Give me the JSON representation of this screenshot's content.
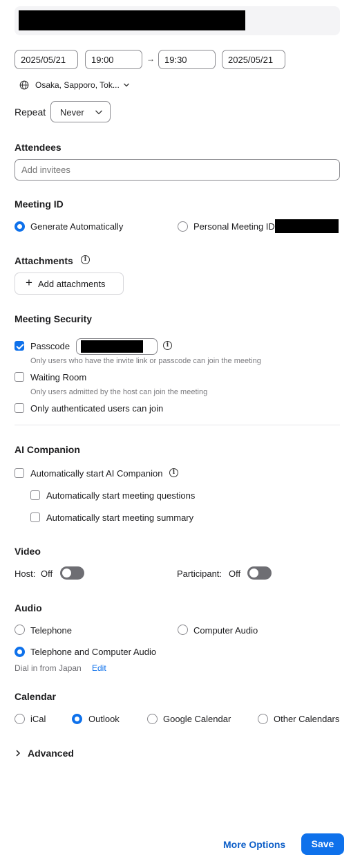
{
  "header": {
    "title_redacted": true
  },
  "schedule": {
    "start_date": "2025/05/21",
    "start_time": "19:00",
    "arrow": "→",
    "end_time": "19:30",
    "end_date": "2025/05/21",
    "timezone": "Osaka, Sapporo, Tok...",
    "repeat_label": "Repeat",
    "repeat_value": "Never"
  },
  "attendees": {
    "heading": "Attendees",
    "placeholder": "Add invitees"
  },
  "meeting_id": {
    "heading": "Meeting ID",
    "generate_label": "Generate Automatically",
    "personal_label": "Personal Meeting ID",
    "selected": "generate"
  },
  "attachments": {
    "heading": "Attachments",
    "add_label": "Add attachments"
  },
  "security": {
    "heading": "Meeting Security",
    "passcode_label": "Passcode",
    "passcode_checked": true,
    "passcode_hint": "Only users who have the invite link or passcode can join the meeting",
    "waiting_room_label": "Waiting Room",
    "waiting_room_checked": false,
    "waiting_room_hint": "Only users admitted by the host can join the meeting",
    "auth_label": "Only authenticated users can join",
    "auth_checked": false
  },
  "ai_companion": {
    "heading": "AI Companion",
    "auto_start_label": "Automatically start AI Companion",
    "questions_label": "Automatically start meeting questions",
    "summary_label": "Automatically start meeting summary"
  },
  "video": {
    "heading": "Video",
    "host_label": "Host:",
    "host_value": "Off",
    "participant_label": "Participant:",
    "participant_value": "Off"
  },
  "audio": {
    "heading": "Audio",
    "telephone_label": "Telephone",
    "computer_label": "Computer Audio",
    "both_label": "Telephone and Computer Audio",
    "selected": "both",
    "dial_in_text": "Dial in from Japan",
    "edit_label": "Edit"
  },
  "calendar": {
    "heading": "Calendar",
    "options": [
      "iCal",
      "Outlook",
      "Google Calendar",
      "Other Calendars"
    ],
    "selected": "Outlook"
  },
  "advanced": {
    "label": "Advanced"
  },
  "footer": {
    "more_options_label": "More Options",
    "save_label": "Save"
  },
  "colors": {
    "accent": "#0e71eb",
    "toggle_off": "#6e6e73",
    "text": "#1d1d1f",
    "hint": "#7a7a7e"
  }
}
